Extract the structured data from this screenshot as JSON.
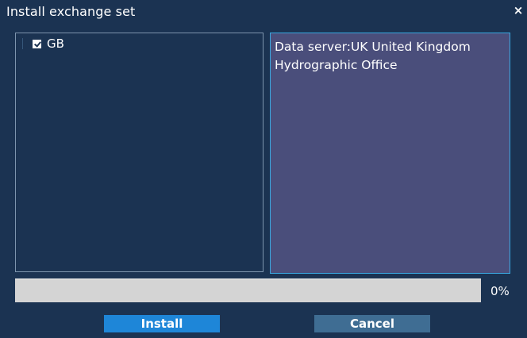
{
  "window": {
    "title": "Install exchange set",
    "close_glyph": "×"
  },
  "tree": {
    "items": [
      {
        "label": "GB",
        "checked": true
      }
    ]
  },
  "info": {
    "text": "Data server:UK United Kingdom Hydrographic Office"
  },
  "progress": {
    "value": 0,
    "label": "0%"
  },
  "buttons": {
    "install_label": "Install",
    "cancel_label": "Cancel"
  },
  "colors": {
    "background": "#1b3352",
    "info_panel": "#4a4e7b",
    "info_border": "#3aa8e0",
    "install_button": "#1e86d8",
    "cancel_button": "#3f6d93"
  },
  "icons": {
    "close": "close-icon",
    "checkbox": "checkbox-checked-icon"
  }
}
